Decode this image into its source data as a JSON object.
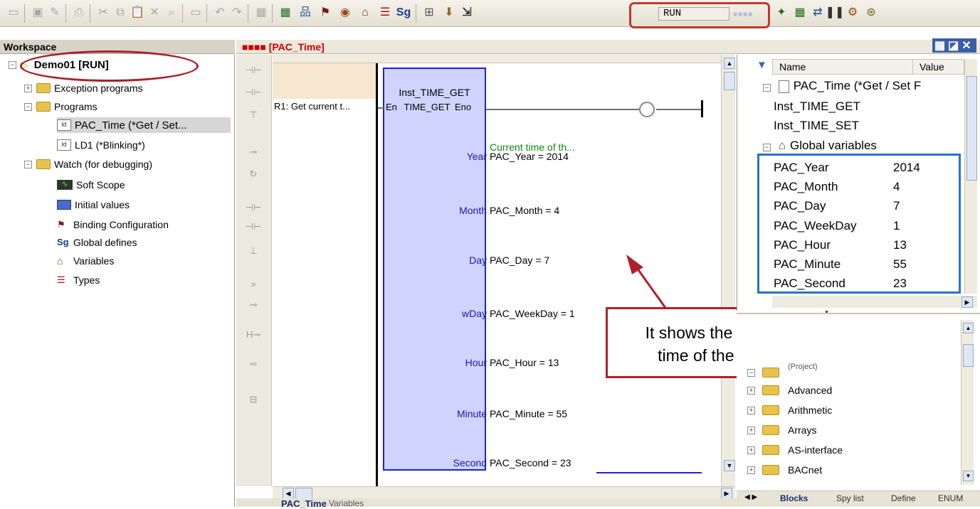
{
  "toolbar": {
    "run_status": "RUN"
  },
  "workspace": {
    "title": "Workspace",
    "tree": [
      {
        "label": "Demo01 [RUN]"
      },
      {
        "label": "Exception programs"
      },
      {
        "label": "Programs"
      },
      {
        "label": "PAC_Time (*Get / Set..."
      },
      {
        "label": "LD1 (*Blinking*)"
      },
      {
        "label": "Watch (for debugging)"
      },
      {
        "label": "Soft Scope"
      },
      {
        "label": "Initial values"
      },
      {
        "label": "Binding Configuration"
      },
      {
        "label": "Global defines"
      },
      {
        "label": "Variables"
      },
      {
        "label": "Types"
      }
    ]
  },
  "editor": {
    "tab_title": "■■■■ [PAC_Time]",
    "rung_label": "R1: Get current t...",
    "block": {
      "instance": "Inst_TIME_GET",
      "en": "En",
      "type": "TIME_GET",
      "eno": "Eno",
      "comment": "Current time of th...",
      "pins": [
        {
          "name": "Year",
          "value": "PAC_Year = 2014"
        },
        {
          "name": "Month",
          "value": "PAC_Month = 4"
        },
        {
          "name": "Day",
          "value": "PAC_Day = 7"
        },
        {
          "name": "wDay",
          "value": "PAC_WeekDay = 1"
        },
        {
          "name": "Hour",
          "value": "PAC_Hour = 13"
        },
        {
          "name": "Minute",
          "value": "PAC_Minute = 55"
        },
        {
          "name": "Second",
          "value": "PAC_Second = 23"
        }
      ]
    },
    "tabs": [
      "PAC_Time",
      "Variables"
    ]
  },
  "callout": {
    "line1": "It shows the current",
    "line2": "time of the PAC."
  },
  "vars_panel": {
    "col_name": "Name",
    "col_value": "Value",
    "rows": [
      {
        "name": "PAC_Time (*Get / Set F",
        "value": ""
      },
      {
        "name": "Inst_TIME_GET",
        "value": ""
      },
      {
        "name": "Inst_TIME_SET",
        "value": ""
      },
      {
        "name": "Global variables",
        "value": ""
      },
      {
        "name": "PAC_Year",
        "value": "2014"
      },
      {
        "name": "PAC_Month",
        "value": "4"
      },
      {
        "name": "PAC_Day",
        "value": "7"
      },
      {
        "name": "PAC_WeekDay",
        "value": "1"
      },
      {
        "name": "PAC_Hour",
        "value": "13"
      },
      {
        "name": "PAC_Minute",
        "value": "55"
      },
      {
        "name": "PAC_Second",
        "value": "23"
      }
    ]
  },
  "library": {
    "items": [
      "(Project)",
      "Advanced",
      "Arithmetic",
      "Arrays",
      "AS-interface",
      "BACnet"
    ],
    "tabs": [
      "Blocks",
      "Spy list",
      "Define",
      "ENUM"
    ]
  },
  "colors": {
    "highlight_red": "#c0392b",
    "block_border": "#2020d8",
    "global_box": "#2c72c4",
    "comment_green": "#108a10"
  }
}
